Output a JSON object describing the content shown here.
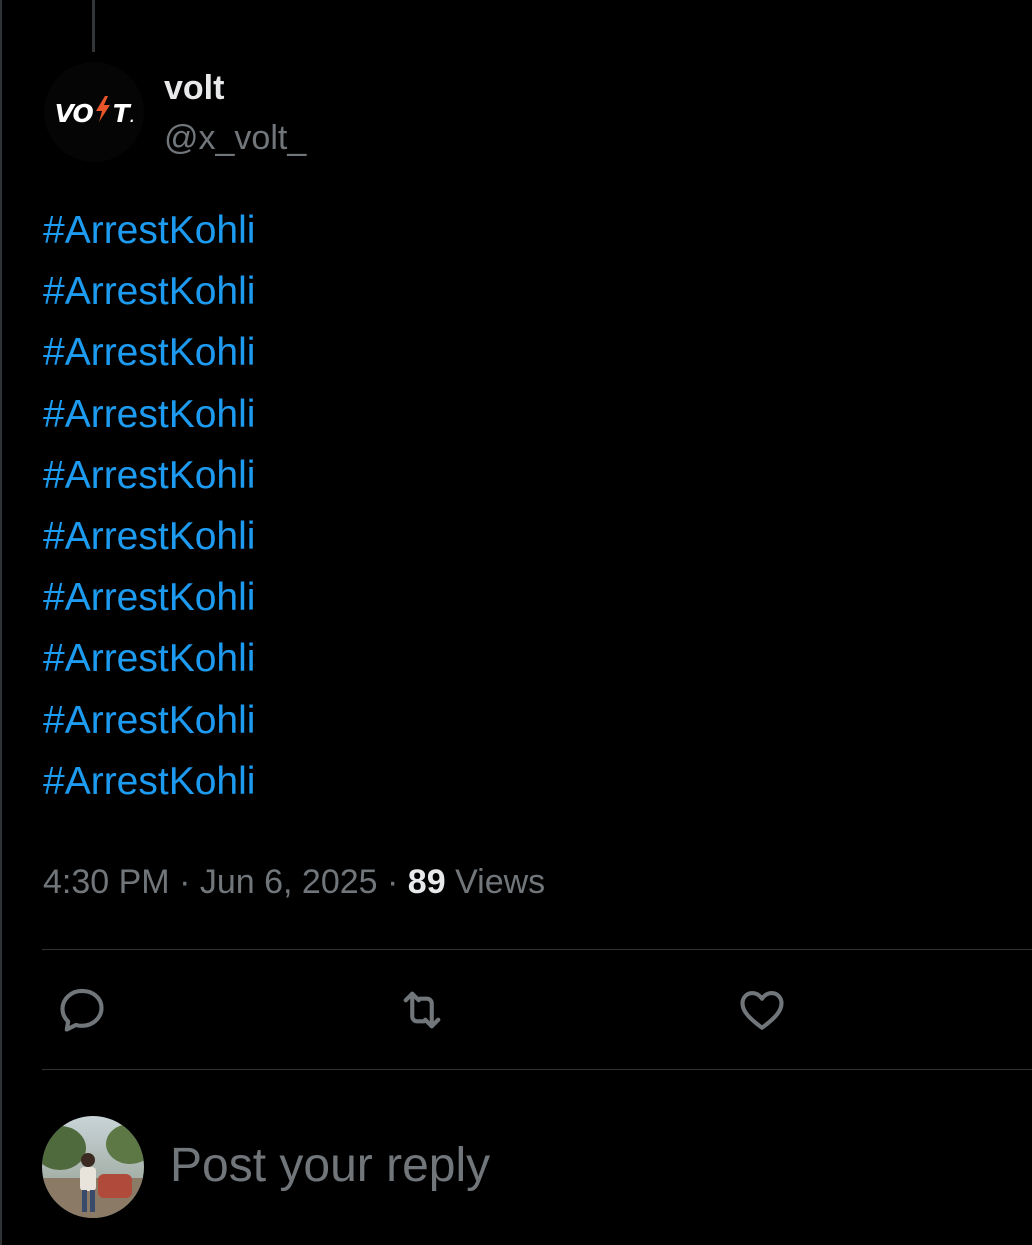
{
  "post": {
    "author": {
      "display_name": "volt",
      "handle": "@x_volt_",
      "avatar_logo_text": "VOLT."
    },
    "hashtags": [
      "#ArrestKohli",
      "#ArrestKohli",
      "#ArrestKohli",
      "#ArrestKohli",
      "#ArrestKohli",
      "#ArrestKohli",
      "#ArrestKohli",
      "#ArrestKohli",
      "#ArrestKohli",
      "#ArrestKohli"
    ],
    "time": "4:30 PM",
    "separator": "·",
    "date": "Jun 6, 2025",
    "views_count": "89",
    "views_label": "Views"
  },
  "actions": {
    "reply_icon": "reply-icon",
    "repost_icon": "repost-icon",
    "like_icon": "heart-icon"
  },
  "reply_box": {
    "placeholder": "Post your reply"
  },
  "colors": {
    "background": "#000000",
    "text_primary": "#e7e9ea",
    "text_secondary": "#71767b",
    "link": "#1d9bf0",
    "border": "#2f3336",
    "logo_accent": "#e8562a"
  }
}
